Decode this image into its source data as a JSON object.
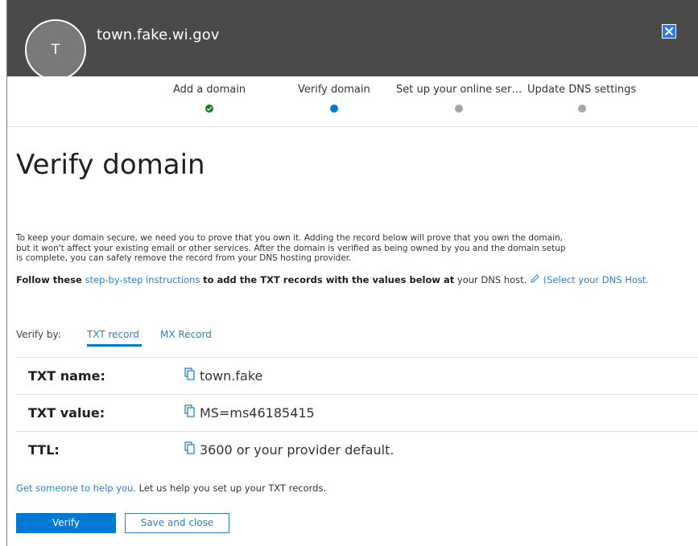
{
  "header": {
    "avatar_letter": "T",
    "title": "town.fake.wi.gov",
    "close_icon": "close-icon"
  },
  "stepper": {
    "steps": [
      {
        "label": "Add a domain",
        "state": "done"
      },
      {
        "label": "Verify domain",
        "state": "active"
      },
      {
        "label": "Set up your online ser…",
        "state": "pending"
      },
      {
        "label": "Update DNS settings",
        "state": "pending"
      }
    ]
  },
  "main": {
    "title": "Verify domain",
    "description": "To keep your domain secure, we need you to prove that you own it. Adding the record below will prove that you own the domain, but it won't affect your existing email or other services. After the domain is verified as being owned by you and the domain setup is complete, you can safely remove the record from your DNS hosting provider.",
    "follow": {
      "prefix": "Follow these",
      "link": "step-by-step instructions",
      "middle": "to add the TXT records with the values below at",
      "suffix": "your DNS host.",
      "select_link": "(Select your DNS Host."
    },
    "verify_by": {
      "label": "Verify by:",
      "tabs": [
        {
          "label": "TXT record",
          "selected": true
        },
        {
          "label": "MX Record",
          "selected": false
        }
      ]
    },
    "records": [
      {
        "label": "TXT name:",
        "value": "town.fake"
      },
      {
        "label": "TXT value:",
        "value": "MS=ms46185415"
      },
      {
        "label": "TTL:",
        "value": "3600 or your provider default."
      }
    ],
    "help": {
      "link": "Get someone to help you.",
      "text": "Let us help you set up your TXT records."
    }
  },
  "actions": {
    "verify_label": "Verify",
    "save_close_label": "Save and close"
  },
  "colors": {
    "header_bg": "#4a4a4a",
    "accent": "#0078d4",
    "link": "#2f80c9",
    "done": "#107c10",
    "pending": "#a6a6a6"
  }
}
